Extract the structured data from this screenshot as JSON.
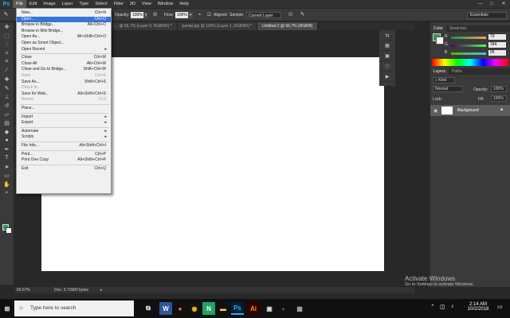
{
  "app": {
    "logo": "Ps"
  },
  "menubar": {
    "items": [
      "File",
      "Edit",
      "Image",
      "Layer",
      "Type",
      "Select",
      "Filter",
      "3D",
      "View",
      "Window",
      "Help"
    ]
  },
  "window_controls": {
    "minimize": "—",
    "maximize": "□",
    "close": "✕"
  },
  "options_bar": {
    "mode_label": "Opacity:",
    "opacity_value": "100%",
    "flow_label": "Flow:",
    "flow_value": "100%",
    "aligned_label": "Aligned",
    "sample_label": "Sample:",
    "sample_value": "Current Layer",
    "workspace_value": "Essentials"
  },
  "tabs": [
    {
      "label": "... @ 66.7% (Layer 0, RGB/8#) *"
    },
    {
      "label": "pantai.jpg @ 100% (Layer 1, RGB/8#) *"
    },
    {
      "label": "Untitled-2 @ 66.7% (RGB/8)"
    }
  ],
  "file_menu": [
    {
      "label": "New...",
      "shortcut": "Ctrl+N",
      "state": "normal"
    },
    {
      "label": "Open...",
      "shortcut": "Ctrl+O",
      "state": "highlighted"
    },
    {
      "label": "Browse in Bridge...",
      "shortcut": "Alt+Ctrl+O",
      "state": "normal"
    },
    {
      "label": "Browse in Mini Bridge...",
      "shortcut": "",
      "state": "normal"
    },
    {
      "label": "Open As...",
      "shortcut": "Alt+Shift+Ctrl+O",
      "state": "normal"
    },
    {
      "label": "Open as Smart Object...",
      "shortcut": "",
      "state": "normal"
    },
    {
      "label": "Open Recent",
      "shortcut": "",
      "state": "submenu"
    },
    {
      "sep": true
    },
    {
      "label": "Close",
      "shortcut": "Ctrl+W",
      "state": "normal"
    },
    {
      "label": "Close All",
      "shortcut": "Alt+Ctrl+W",
      "state": "normal"
    },
    {
      "label": "Close and Go to Bridge...",
      "shortcut": "Shift+Ctrl+W",
      "state": "normal"
    },
    {
      "label": "Save",
      "shortcut": "Ctrl+S",
      "state": "disabled"
    },
    {
      "label": "Save As...",
      "shortcut": "Shift+Ctrl+S",
      "state": "normal"
    },
    {
      "label": "Check In...",
      "shortcut": "",
      "state": "disabled"
    },
    {
      "label": "Save for Web...",
      "shortcut": "Alt+Shift+Ctrl+S",
      "state": "normal"
    },
    {
      "label": "Revert",
      "shortcut": "F12",
      "state": "disabled"
    },
    {
      "sep": true
    },
    {
      "label": "Place...",
      "shortcut": "",
      "state": "normal"
    },
    {
      "sep": true
    },
    {
      "label": "Import",
      "shortcut": "",
      "state": "submenu"
    },
    {
      "label": "Export",
      "shortcut": "",
      "state": "submenu"
    },
    {
      "sep": true
    },
    {
      "label": "Automate",
      "shortcut": "",
      "state": "submenu"
    },
    {
      "label": "Scripts",
      "shortcut": "",
      "state": "submenu"
    },
    {
      "sep": true
    },
    {
      "label": "File Info...",
      "shortcut": "Alt+Shift+Ctrl+I",
      "state": "normal"
    },
    {
      "sep": true
    },
    {
      "label": "Print...",
      "shortcut": "Ctrl+P",
      "state": "normal"
    },
    {
      "label": "Print One Copy",
      "shortcut": "Alt+Shift+Ctrl+P",
      "state": "normal"
    },
    {
      "sep": true
    },
    {
      "label": "Exit",
      "shortcut": "Ctrl+Q",
      "state": "normal"
    }
  ],
  "color_panel": {
    "tabs": [
      "Color",
      "Swatches"
    ],
    "r_label": "R",
    "g_label": "G",
    "b_label": "B",
    "r": "79",
    "g": "184",
    "b": "95"
  },
  "layers_panel": {
    "tabs": [
      "Layers",
      "Paths"
    ],
    "kind": "Kind",
    "blend": "Normal",
    "opacity_label": "Opacity:",
    "opacity": "100%",
    "lock_label": "Lock:",
    "fill_label": "Fill:",
    "fill": "100%",
    "layer_name": "Background"
  },
  "status": {
    "zoom": "66.67%",
    "doc": "Doc: 3.71M/0 bytes"
  },
  "watermark": {
    "title": "Activate Windows",
    "subtitle": "Go to Settings to activate Windows."
  },
  "taskbar": {
    "search_placeholder": "Type here to search",
    "time": "2:14 AM",
    "date": "10/2/2018"
  },
  "colors": {
    "accent": "#3874d8",
    "fg_color": "#2f9a5a",
    "ps_blue": "#31a8ff"
  }
}
